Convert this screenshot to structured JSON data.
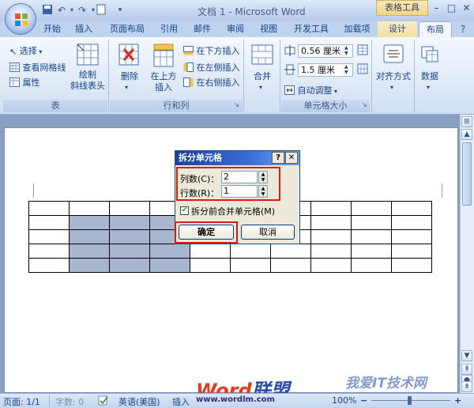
{
  "titlebar": {
    "doc_title": "文档 1 - Microsoft Word",
    "context_tools": "表格工具"
  },
  "tabs": [
    "开始",
    "插入",
    "页面布局",
    "引用",
    "邮件",
    "审阅",
    "视图",
    "开发工具",
    "加载项",
    "设计",
    "布局"
  ],
  "ribbon": {
    "table_group": {
      "select": "选择",
      "view_gridlines": "查看网格线",
      "properties": "属性",
      "draw_diagonal_1": "绘制",
      "draw_diagonal_2": "斜线表头",
      "label": "表"
    },
    "rows_cols_group": {
      "delete": "删除",
      "insert_above_1": "在上方",
      "insert_above_2": "插入",
      "insert_below": "在下方插入",
      "insert_left": "在左侧插入",
      "insert_right": "在右侧插入",
      "label": "行和列"
    },
    "merge_group": {
      "merge": "合并"
    },
    "cell_size_group": {
      "height_value": "0.56 厘米",
      "width_value": "1.5 厘米",
      "autofit": "自动调整",
      "label": "单元格大小"
    },
    "alignment": "对齐方式",
    "data": "数据"
  },
  "dialog": {
    "title": "拆分单元格",
    "help": "?",
    "close": "✕",
    "columns_label": "列数(C)：",
    "columns_value": "2",
    "rows_label": "行数(R)：",
    "rows_value": "1",
    "merge_before_split": "拆分前合并单元格(M)",
    "ok": "确定",
    "cancel": "取消"
  },
  "status_bar": {
    "page": "页面: 1/1",
    "words": "字数: 0",
    "language": "英语(美国)",
    "insert_mode": "插入",
    "zoom": "100%"
  },
  "watermarks": {
    "brand_word": "Word",
    "brand_cn": "联盟",
    "site": "www.wordlm.com",
    "right_brand": "我爱IT技术网"
  },
  "colors": {
    "accent_red": "#e01818",
    "selection": "#a9b6cf",
    "ribbon_bg": "#dbe7f6",
    "title_gradient": "#1e3fa0"
  }
}
